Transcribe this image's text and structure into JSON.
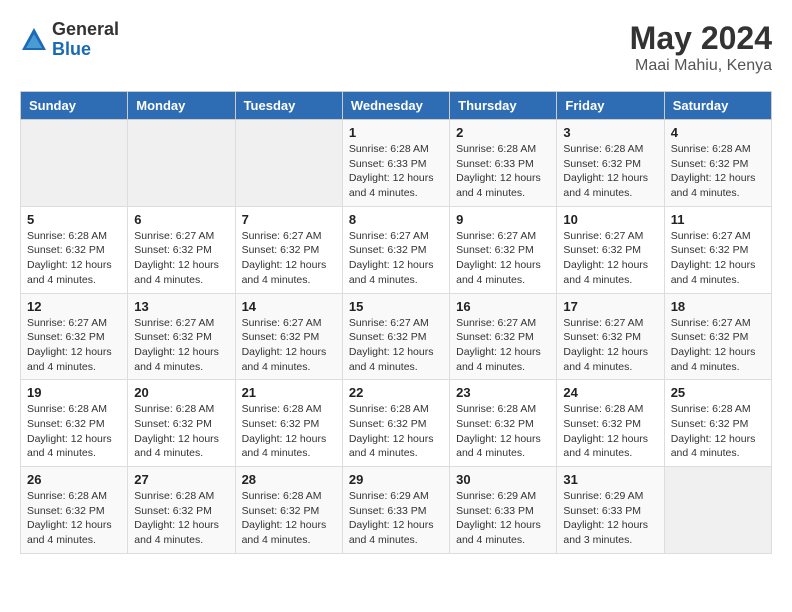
{
  "header": {
    "logo_general": "General",
    "logo_blue": "Blue",
    "month_year": "May 2024",
    "location": "Maai Mahiu, Kenya"
  },
  "calendar": {
    "days_of_week": [
      "Sunday",
      "Monday",
      "Tuesday",
      "Wednesday",
      "Thursday",
      "Friday",
      "Saturday"
    ],
    "weeks": [
      [
        {
          "day": "",
          "info": ""
        },
        {
          "day": "",
          "info": ""
        },
        {
          "day": "",
          "info": ""
        },
        {
          "day": "1",
          "sunrise": "6:28 AM",
          "sunset": "6:33 PM",
          "daylight": "12 hours and 4 minutes."
        },
        {
          "day": "2",
          "sunrise": "6:28 AM",
          "sunset": "6:33 PM",
          "daylight": "12 hours and 4 minutes."
        },
        {
          "day": "3",
          "sunrise": "6:28 AM",
          "sunset": "6:32 PM",
          "daylight": "12 hours and 4 minutes."
        },
        {
          "day": "4",
          "sunrise": "6:28 AM",
          "sunset": "6:32 PM",
          "daylight": "12 hours and 4 minutes."
        }
      ],
      [
        {
          "day": "5",
          "sunrise": "6:28 AM",
          "sunset": "6:32 PM",
          "daylight": "12 hours and 4 minutes."
        },
        {
          "day": "6",
          "sunrise": "6:27 AM",
          "sunset": "6:32 PM",
          "daylight": "12 hours and 4 minutes."
        },
        {
          "day": "7",
          "sunrise": "6:27 AM",
          "sunset": "6:32 PM",
          "daylight": "12 hours and 4 minutes."
        },
        {
          "day": "8",
          "sunrise": "6:27 AM",
          "sunset": "6:32 PM",
          "daylight": "12 hours and 4 minutes."
        },
        {
          "day": "9",
          "sunrise": "6:27 AM",
          "sunset": "6:32 PM",
          "daylight": "12 hours and 4 minutes."
        },
        {
          "day": "10",
          "sunrise": "6:27 AM",
          "sunset": "6:32 PM",
          "daylight": "12 hours and 4 minutes."
        },
        {
          "day": "11",
          "sunrise": "6:27 AM",
          "sunset": "6:32 PM",
          "daylight": "12 hours and 4 minutes."
        }
      ],
      [
        {
          "day": "12",
          "sunrise": "6:27 AM",
          "sunset": "6:32 PM",
          "daylight": "12 hours and 4 minutes."
        },
        {
          "day": "13",
          "sunrise": "6:27 AM",
          "sunset": "6:32 PM",
          "daylight": "12 hours and 4 minutes."
        },
        {
          "day": "14",
          "sunrise": "6:27 AM",
          "sunset": "6:32 PM",
          "daylight": "12 hours and 4 minutes."
        },
        {
          "day": "15",
          "sunrise": "6:27 AM",
          "sunset": "6:32 PM",
          "daylight": "12 hours and 4 minutes."
        },
        {
          "day": "16",
          "sunrise": "6:27 AM",
          "sunset": "6:32 PM",
          "daylight": "12 hours and 4 minutes."
        },
        {
          "day": "17",
          "sunrise": "6:27 AM",
          "sunset": "6:32 PM",
          "daylight": "12 hours and 4 minutes."
        },
        {
          "day": "18",
          "sunrise": "6:27 AM",
          "sunset": "6:32 PM",
          "daylight": "12 hours and 4 minutes."
        }
      ],
      [
        {
          "day": "19",
          "sunrise": "6:28 AM",
          "sunset": "6:32 PM",
          "daylight": "12 hours and 4 minutes."
        },
        {
          "day": "20",
          "sunrise": "6:28 AM",
          "sunset": "6:32 PM",
          "daylight": "12 hours and 4 minutes."
        },
        {
          "day": "21",
          "sunrise": "6:28 AM",
          "sunset": "6:32 PM",
          "daylight": "12 hours and 4 minutes."
        },
        {
          "day": "22",
          "sunrise": "6:28 AM",
          "sunset": "6:32 PM",
          "daylight": "12 hours and 4 minutes."
        },
        {
          "day": "23",
          "sunrise": "6:28 AM",
          "sunset": "6:32 PM",
          "daylight": "12 hours and 4 minutes."
        },
        {
          "day": "24",
          "sunrise": "6:28 AM",
          "sunset": "6:32 PM",
          "daylight": "12 hours and 4 minutes."
        },
        {
          "day": "25",
          "sunrise": "6:28 AM",
          "sunset": "6:32 PM",
          "daylight": "12 hours and 4 minutes."
        }
      ],
      [
        {
          "day": "26",
          "sunrise": "6:28 AM",
          "sunset": "6:32 PM",
          "daylight": "12 hours and 4 minutes."
        },
        {
          "day": "27",
          "sunrise": "6:28 AM",
          "sunset": "6:32 PM",
          "daylight": "12 hours and 4 minutes."
        },
        {
          "day": "28",
          "sunrise": "6:28 AM",
          "sunset": "6:32 PM",
          "daylight": "12 hours and 4 minutes."
        },
        {
          "day": "29",
          "sunrise": "6:29 AM",
          "sunset": "6:33 PM",
          "daylight": "12 hours and 4 minutes."
        },
        {
          "day": "30",
          "sunrise": "6:29 AM",
          "sunset": "6:33 PM",
          "daylight": "12 hours and 4 minutes."
        },
        {
          "day": "31",
          "sunrise": "6:29 AM",
          "sunset": "6:33 PM",
          "daylight": "12 hours and 3 minutes."
        },
        {
          "day": "",
          "info": ""
        }
      ]
    ]
  }
}
